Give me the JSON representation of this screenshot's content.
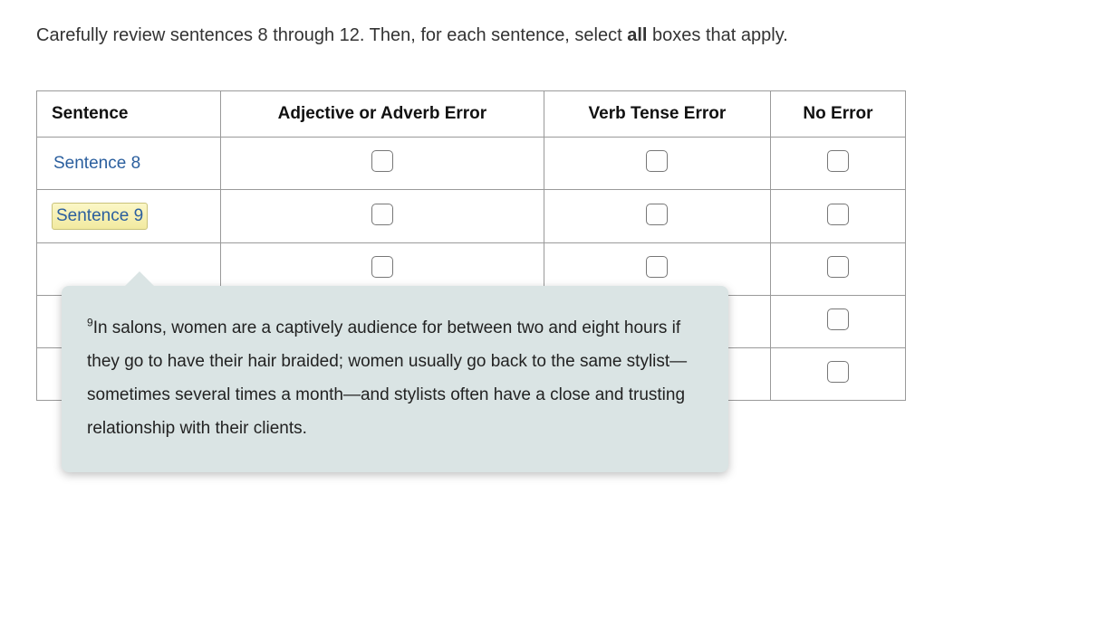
{
  "instruction_prefix": "Carefully review sentences 8 through 12. Then, for each sentence, select ",
  "instruction_bold": "all",
  "instruction_suffix": " boxes that apply.",
  "headers": {
    "sentence": "Sentence",
    "adj_adv": "Adjective or Adverb Error",
    "verb": "Verb Tense Error",
    "noerr": "No Error"
  },
  "rows": [
    {
      "label": "Sentence 8",
      "highlighted": false
    },
    {
      "label": "Sentence 9",
      "highlighted": true
    },
    {
      "label": "",
      "highlighted": false
    },
    {
      "label": "",
      "highlighted": false
    },
    {
      "label": "",
      "highlighted": false
    }
  ],
  "tooltip": {
    "sup": "9",
    "text": "In salons, women are a captively audience for between two and eight hours if they go to have their hair braided; women usually go back to the same stylist—sometimes several times a month—and stylists often have a close and trusting relationship with their clients."
  }
}
